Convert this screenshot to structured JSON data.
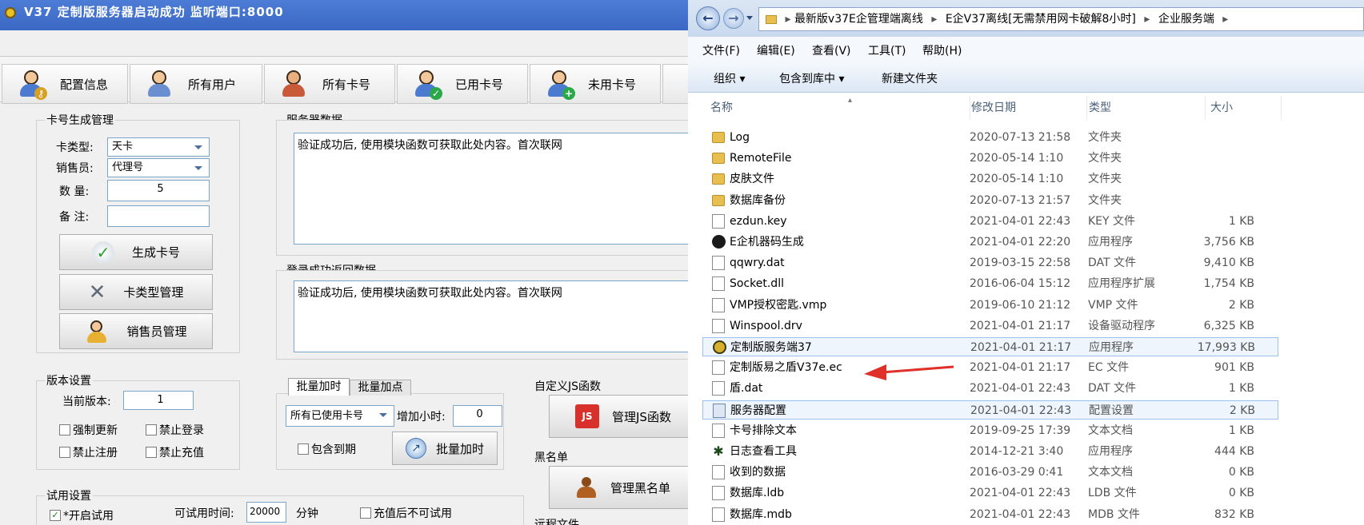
{
  "left_app": {
    "title": "V37 定制版服务器启动成功   监听端口:8000",
    "toolbar": [
      {
        "label": "配置信息",
        "icon": "user-key-icon"
      },
      {
        "label": "所有用户",
        "icon": "users-group-icon"
      },
      {
        "label": "所有卡号",
        "icon": "users-pair-icon"
      },
      {
        "label": "已用卡号",
        "icon": "user-check-icon"
      },
      {
        "label": "未用卡号",
        "icon": "user-add-icon"
      }
    ],
    "card_gen": {
      "title": "卡号生成管理",
      "card_type_label": "卡类型:",
      "card_type_value": "天卡",
      "seller_label": "销售员:",
      "seller_value": "代理号",
      "qty_label": "数  量:",
      "qty_value": "5",
      "note_label": "备  注:",
      "note_value": "",
      "btn_generate": "生成卡号",
      "btn_type_manage": "卡类型管理",
      "btn_seller_manage": "销售员管理"
    },
    "server_data": {
      "title": "服务器数据",
      "text": "验证成功后, 使用模块函数可获取此处内容。首次联网"
    },
    "login_data": {
      "title": "登录成功返回数据",
      "text": "验证成功后, 使用模块函数可获取此处内容。首次联网"
    },
    "version": {
      "title": "版本设置",
      "current_label": "当前版本:",
      "current_value": "1",
      "force_update": "强制更新",
      "no_login": "禁止登录",
      "no_register": "禁止注册",
      "no_recharge": "禁止充值"
    },
    "batch": {
      "tab1": "批量加时",
      "tab2": "批量加点",
      "scope_value": "所有已使用卡号",
      "add_hours_label": "增加小时:",
      "add_hours_value": "0",
      "include_expired": "包含到期",
      "btn_batch_add": "批量加时"
    },
    "js": {
      "title": "自定义JS函数",
      "btn": "管理JS函数",
      "badge": "JS"
    },
    "blacklist": {
      "title": "黑名单",
      "btn": "管理黑名单"
    },
    "trial": {
      "title": "试用设置",
      "enable_label": "*开启试用",
      "time_label": "可试用时间:",
      "time_value": "20000",
      "unit": "分钟",
      "no_trial_after_recharge": "充值后不可试用"
    },
    "remote_files": {
      "title": "远程文件"
    }
  },
  "explorer": {
    "breadcrumb": [
      "最新版v37E企管理端离线",
      "E企V37离线[无需禁用网卡破解8小时]",
      "企业服务端"
    ],
    "menu": [
      "文件(F)",
      "编辑(E)",
      "查看(V)",
      "工具(T)",
      "帮助(H)"
    ],
    "commands": [
      "组织 ▾",
      "包含到库中 ▾",
      "新建文件夹"
    ],
    "columns": {
      "name": "名称",
      "date": "修改日期",
      "type": "类型",
      "size": "大小"
    },
    "files": [
      {
        "name": "Log",
        "date": "2020-07-13 21:58",
        "type": "文件夹",
        "size": "",
        "icon": "folder"
      },
      {
        "name": "RemoteFile",
        "date": "2020-05-14 1:10",
        "type": "文件夹",
        "size": "",
        "icon": "folder"
      },
      {
        "name": "皮肤文件",
        "date": "2020-05-14 1:10",
        "type": "文件夹",
        "size": "",
        "icon": "folder"
      },
      {
        "name": "数据库备份",
        "date": "2020-07-13 21:57",
        "type": "文件夹",
        "size": "",
        "icon": "folder"
      },
      {
        "name": "ezdun.key",
        "date": "2021-04-01 22:43",
        "type": "KEY 文件",
        "size": "1 KB",
        "icon": "file"
      },
      {
        "name": "E企机器码生成",
        "date": "2021-04-01 22:20",
        "type": "应用程序",
        "size": "3,756 KB",
        "icon": "app"
      },
      {
        "name": "qqwry.dat",
        "date": "2019-03-15 22:58",
        "type": "DAT 文件",
        "size": "9,410 KB",
        "icon": "file"
      },
      {
        "name": "Socket.dll",
        "date": "2016-06-04 15:12",
        "type": "应用程序扩展",
        "size": "1,754 KB",
        "icon": "dll"
      },
      {
        "name": "VMP授权密匙.vmp",
        "date": "2019-06-10 21:12",
        "type": "VMP 文件",
        "size": "2 KB",
        "icon": "file"
      },
      {
        "name": "Winspool.drv",
        "date": "2021-04-01 21:17",
        "type": "设备驱动程序",
        "size": "6,325 KB",
        "icon": "dll"
      },
      {
        "name": "定制版服务端37",
        "date": "2021-04-01 21:17",
        "type": "应用程序",
        "size": "17,993 KB",
        "icon": "gold"
      },
      {
        "name": "定制版易之盾V37e.ec",
        "date": "2021-04-01 21:17",
        "type": "EC 文件",
        "size": "901 KB",
        "icon": "file"
      },
      {
        "name": "盾.dat",
        "date": "2021-04-01 22:43",
        "type": "DAT 文件",
        "size": "1 KB",
        "icon": "file"
      },
      {
        "name": "服务器配置",
        "date": "2021-04-01 22:43",
        "type": "配置设置",
        "size": "2 KB",
        "icon": "cfg"
      },
      {
        "name": "卡号排除文本",
        "date": "2019-09-25 17:39",
        "type": "文本文档",
        "size": "1 KB",
        "icon": "file"
      },
      {
        "name": "日志查看工具",
        "date": "2014-12-21 3:40",
        "type": "应用程序",
        "size": "444 KB",
        "icon": "tool"
      },
      {
        "name": "收到的数据",
        "date": "2016-03-29 0:41",
        "type": "文本文档",
        "size": "0 KB",
        "icon": "file"
      },
      {
        "name": "数据库.ldb",
        "date": "2021-04-01 22:43",
        "type": "LDB 文件",
        "size": "0 KB",
        "icon": "file"
      },
      {
        "name": "数据库.mdb",
        "date": "2021-04-01 22:43",
        "type": "MDB 文件",
        "size": "832 KB",
        "icon": "file"
      }
    ]
  },
  "colors": {
    "title_bar": "#3a68c4",
    "arrow": "#e0302a",
    "highlight": "#eef5fd"
  }
}
